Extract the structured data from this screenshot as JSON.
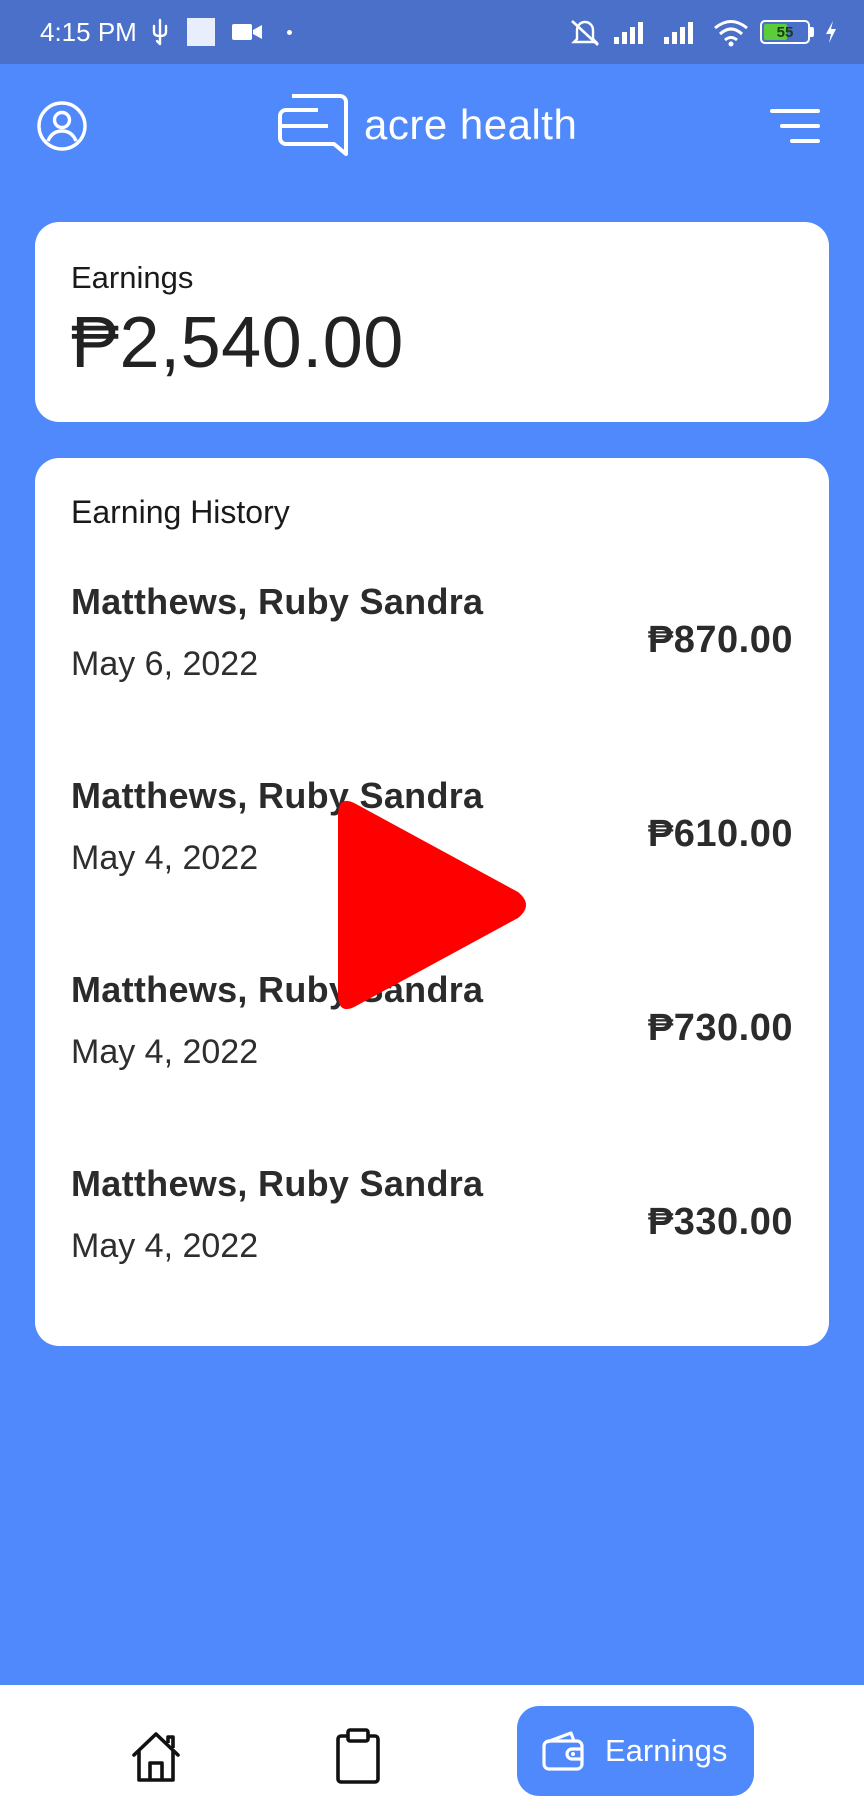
{
  "status_bar": {
    "time": "4:15 PM",
    "battery_level": "55",
    "battery_fraction": 0.55
  },
  "header": {
    "app_name": "acre health",
    "icons": [
      "profile-icon",
      "logo-chat-icon",
      "menu-icon"
    ]
  },
  "earnings": {
    "label": "Earnings",
    "total": "₱2,540.00"
  },
  "history": {
    "title": "Earning History",
    "rows": [
      {
        "name": "Matthews, Ruby Sandra",
        "date": "May 6, 2022",
        "amount": "₱870.00"
      },
      {
        "name": "Matthews, Ruby Sandra",
        "date": "May 4, 2022",
        "amount": "₱610.00"
      },
      {
        "name": "Matthews, Ruby Sandra",
        "date": "May 4, 2022",
        "amount": "₱730.00"
      },
      {
        "name": "Matthews, Ruby Sandra",
        "date": "May 4, 2022",
        "amount": "₱330.00"
      }
    ]
  },
  "bottom_nav": {
    "items": [
      "home-icon",
      "clipboard-icon",
      "wallet-icon"
    ],
    "active_label": "Earnings"
  },
  "colors": {
    "background": "#5089FB",
    "status_bar": "#4A70C9",
    "card": "#FFFFFF",
    "play_overlay": "#FF0000"
  }
}
